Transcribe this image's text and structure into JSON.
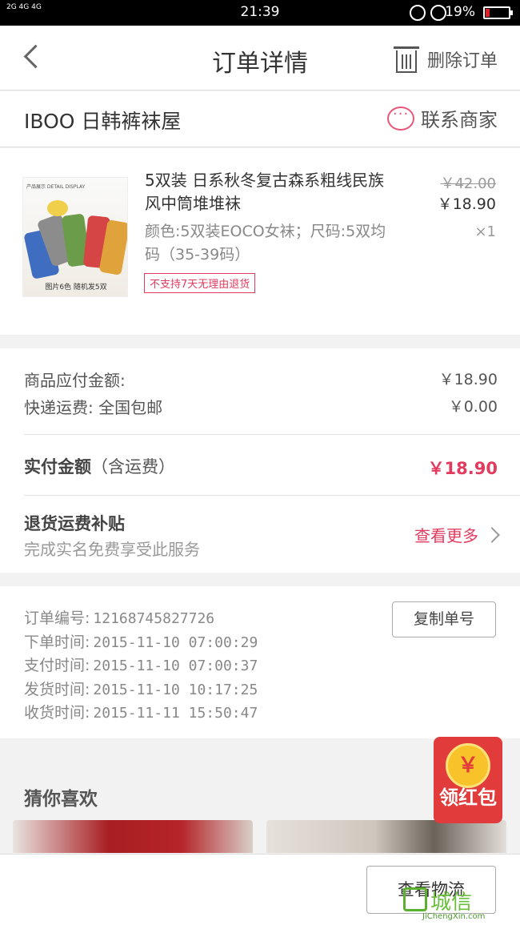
{
  "status_bar": {
    "network": "2G 4G 4G",
    "time": "21:39",
    "battery": "19%",
    "battery_level": 0.19
  },
  "header": {
    "title": "订单详情",
    "delete_label": "删除订单"
  },
  "shop": {
    "name": "IBOO 日韩裤袜屋",
    "contact_label": "联系商家"
  },
  "product": {
    "name": "5双装 日系秋冬复古森系粗线民族风中筒堆堆袜",
    "spec": "颜色:5双装EOCO女袜；尺码:5双均码（35-39码）",
    "tag": "不支持7天无理由退货",
    "original_price": "￥42.00",
    "price": "￥18.90",
    "quantity": "×1",
    "thumb_caption": "图片6色 随机发5双",
    "thumb_banner": "产品展示 DETAIL DISPLAY"
  },
  "amounts": {
    "goods_label": "商品应付金额:",
    "goods_value": "￥18.90",
    "shipping_label": "快递运费: 全国包邮",
    "shipping_value": "￥0.00",
    "paid_label": "实付金额",
    "paid_sub": "（含运费）",
    "paid_value": "￥18.90",
    "subsidy_title": "退货运费补贴",
    "subsidy_desc": "完成实名免费享受此服务",
    "subsidy_more": "查看更多"
  },
  "order_info": {
    "order_no_label": "订单编号:",
    "order_no": "12168745827726",
    "order_time_label": "下单时间:",
    "order_time": "2015-11-10  07:00:29",
    "pay_time_label": "支付时间:",
    "pay_time": "2015-11-10  07:00:37",
    "ship_time_label": "发货时间:",
    "ship_time": "2015-11-10  10:17:25",
    "receive_time_label": "收货时间:",
    "receive_time": "2015-11-11  15:50:47",
    "copy_button": "复制单号"
  },
  "recommend": {
    "title": "猜你喜欢",
    "red_packet_symbol": "￥",
    "red_packet_label": "领红包"
  },
  "bottom": {
    "logistics_button": "查看物流"
  },
  "watermark": {
    "main": "城信",
    "sub": "JiChengXin.com"
  },
  "colors": {
    "accent": "#e23b5f",
    "red_packet": "#e23b3b",
    "coin": "#f8c22a"
  }
}
